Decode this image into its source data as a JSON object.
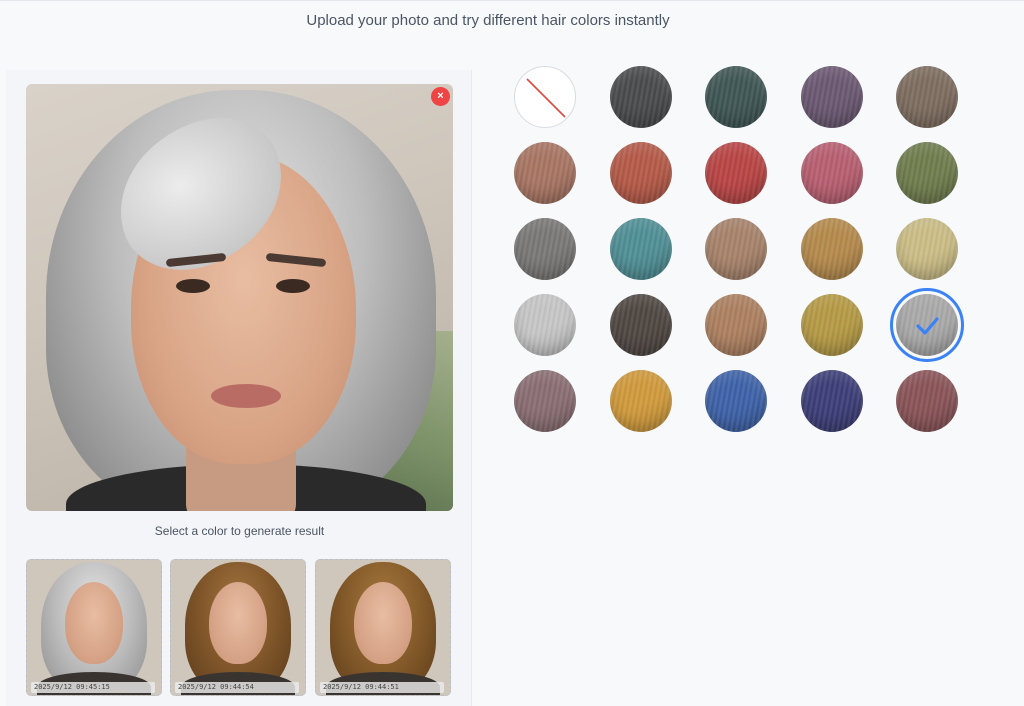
{
  "header": {
    "subtitle": "Upload your photo and try different hair colors instantly"
  },
  "preview": {
    "hint": "Select a color to generate result",
    "remove_label": "×"
  },
  "history": [
    {
      "timestamp": "2025/9/12 09:45:15",
      "hair": "gray"
    },
    {
      "timestamp": "2025/9/12 09:44:54",
      "hair": "brown-curly"
    },
    {
      "timestamp": "2025/9/12 09:44:51",
      "hair": "brown-curly"
    }
  ],
  "swatches": [
    {
      "name": "none",
      "color": "#ffffff"
    },
    {
      "name": "black",
      "color": "#4a4b4c"
    },
    {
      "name": "dark-teal",
      "color": "#3f5655"
    },
    {
      "name": "plum",
      "color": "#6b5872"
    },
    {
      "name": "ash-brown",
      "color": "#7e6d60"
    },
    {
      "name": "copper-brown",
      "color": "#a87563"
    },
    {
      "name": "copper-red",
      "color": "#b55a48"
    },
    {
      "name": "red",
      "color": "#b94545"
    },
    {
      "name": "rose",
      "color": "#b85f71"
    },
    {
      "name": "olive",
      "color": "#6f7d4d"
    },
    {
      "name": "ash-gray",
      "color": "#7a7876"
    },
    {
      "name": "teal",
      "color": "#4f8f95"
    },
    {
      "name": "light-brown",
      "color": "#a7836b"
    },
    {
      "name": "caramel",
      "color": "#b58a4c"
    },
    {
      "name": "blonde",
      "color": "#cbbd86"
    },
    {
      "name": "silver",
      "color": "#c6c6c6"
    },
    {
      "name": "dark-brown",
      "color": "#4f4742"
    },
    {
      "name": "tan-brown",
      "color": "#ad8060"
    },
    {
      "name": "gold",
      "color": "#b59a45"
    },
    {
      "name": "gray",
      "color": "#a9a9a9",
      "selected": true
    },
    {
      "name": "mauve",
      "color": "#8a6e73"
    },
    {
      "name": "honey",
      "color": "#d09a3c"
    },
    {
      "name": "blue",
      "color": "#3e62a8"
    },
    {
      "name": "navy-purple",
      "color": "#3d3e78"
    },
    {
      "name": "burgundy",
      "color": "#8a5458"
    }
  ],
  "colors": {
    "accent": "#3b82f6",
    "danger": "#ef4444"
  }
}
